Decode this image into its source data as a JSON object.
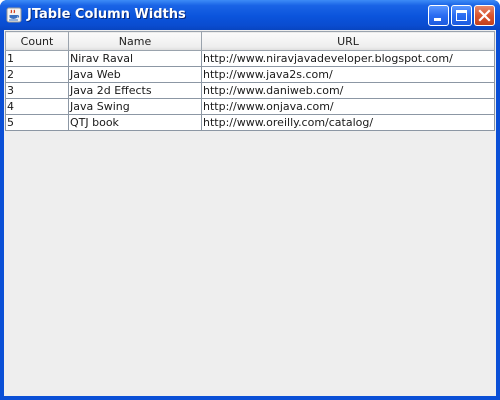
{
  "window": {
    "title": "JTable Column Widths",
    "controls": {
      "minimize_icon": "minimize-icon",
      "maximize_icon": "maximize-icon",
      "close_icon": "close-icon"
    },
    "app_icon": "java-cup-icon",
    "colors": {
      "titlebar": "#0a4fd6",
      "close_button": "#d9552f",
      "client_background": "#eeeeee"
    }
  },
  "table": {
    "columns": [
      "Count",
      "Name",
      "URL"
    ],
    "rows": [
      [
        "1",
        "Nirav Raval",
        "http://www.niravjavadeveloper.blogspot.com/"
      ],
      [
        "2",
        "Java Web",
        "http://www.java2s.com/"
      ],
      [
        "3",
        "Java 2d Effects",
        "http://www.daniweb.com/"
      ],
      [
        "4",
        "Java Swing",
        "http://www.onjava.com/"
      ],
      [
        "5",
        "QTJ book",
        "http://www.oreilly.com/catalog/"
      ]
    ]
  }
}
